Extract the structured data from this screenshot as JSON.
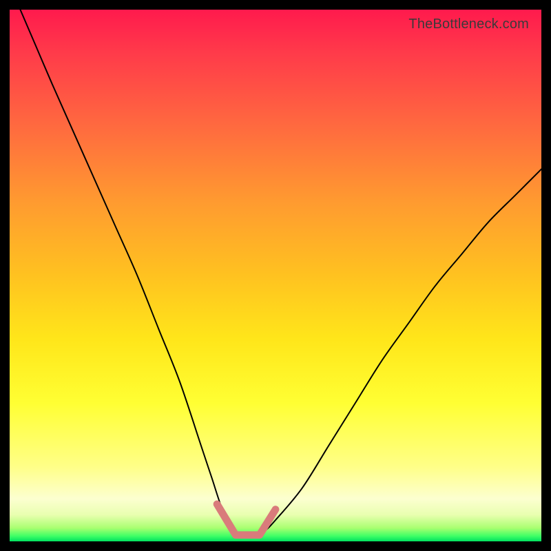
{
  "attribution": "TheBottleneck.com",
  "colors": {
    "curve": "#000000",
    "trough_marker": "#d97b7b",
    "frame": "#000000"
  },
  "chart_data": {
    "type": "line",
    "title": "",
    "xlabel": "",
    "ylabel": "",
    "xlim": [
      0,
      100
    ],
    "ylim": [
      0,
      100
    ],
    "grid": false,
    "legend": false,
    "series": [
      {
        "name": "bottleneck-curve",
        "x": [
          2,
          5,
          8,
          12,
          16,
          20,
          24,
          28,
          32,
          36,
          38,
          40,
          42,
          44,
          46,
          48,
          50,
          55,
          60,
          65,
          70,
          75,
          80,
          85,
          90,
          95,
          100
        ],
        "y": [
          100,
          93,
          86,
          77,
          68,
          59,
          50,
          40,
          30,
          18,
          12,
          6,
          2,
          1,
          1,
          2,
          4,
          10,
          18,
          26,
          34,
          41,
          48,
          54,
          60,
          65,
          70
        ]
      }
    ],
    "annotations": [
      {
        "name": "trough-marker",
        "type": "segment",
        "points": [
          {
            "x": 39,
            "y": 7
          },
          {
            "x": 42.5,
            "y": 1.2
          },
          {
            "x": 47,
            "y": 1.2
          },
          {
            "x": 50,
            "y": 6
          }
        ],
        "stroke_width_percent": 1.4
      }
    ]
  }
}
